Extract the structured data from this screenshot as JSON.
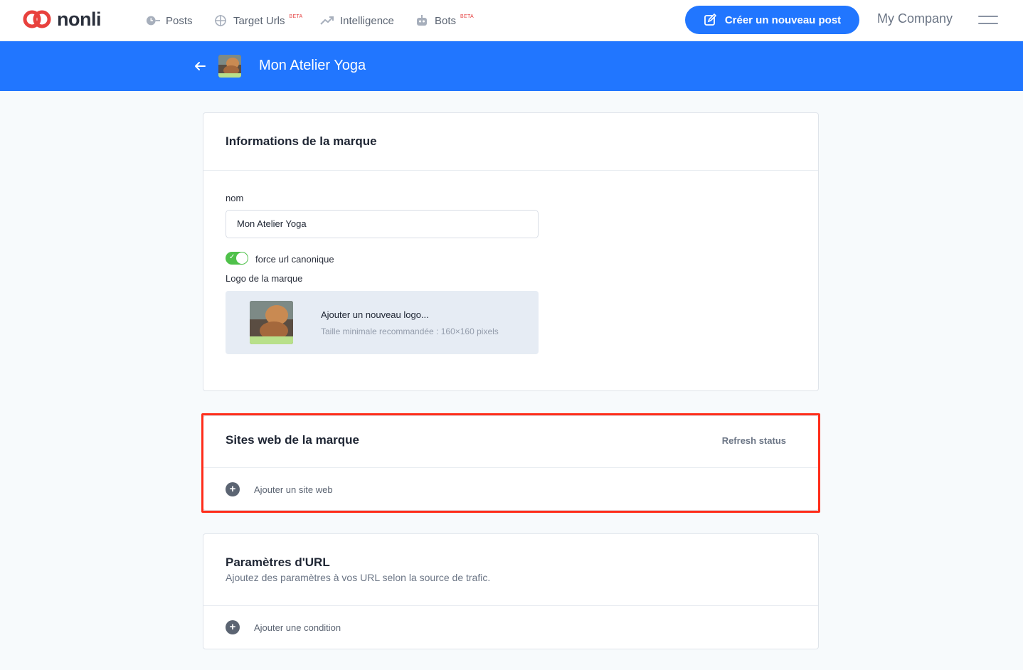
{
  "nav": {
    "logo_text": "nonli",
    "items": [
      {
        "label": "Posts",
        "icon": "clock-icon",
        "beta": ""
      },
      {
        "label": "Target Urls",
        "icon": "crosshair-icon",
        "beta": "BETA"
      },
      {
        "label": "Intelligence",
        "icon": "trend-icon",
        "beta": ""
      },
      {
        "label": "Bots",
        "icon": "robot-icon",
        "beta": "BETA"
      }
    ],
    "cta_label": "Créer un nouveau post",
    "company": "My Company"
  },
  "header": {
    "title": "Mon Atelier Yoga"
  },
  "brand_info": {
    "title": "Informations de la marque",
    "name_label": "nom",
    "name_value": "Mon Atelier Yoga",
    "toggle_label": "force url canonique",
    "toggle_on": true,
    "logo_label": "Logo de la marque",
    "upload_title": "Ajouter un nouveau logo...",
    "upload_hint": "Taille minimale recommandée : 160×160 pixels"
  },
  "websites": {
    "title": "Sites web de la marque",
    "refresh_label": "Refresh status",
    "add_label": "Ajouter un site web"
  },
  "url_params": {
    "title": "Paramètres d'URL",
    "subtitle": "Ajoutez des paramètres à vos URL selon la source de trafic.",
    "add_label": "Ajouter une condition"
  },
  "colors": {
    "primary": "#2176ff",
    "toggle_on": "#4fc14a",
    "highlight": "#ff2d1a",
    "logo_red": "#e8413d"
  }
}
